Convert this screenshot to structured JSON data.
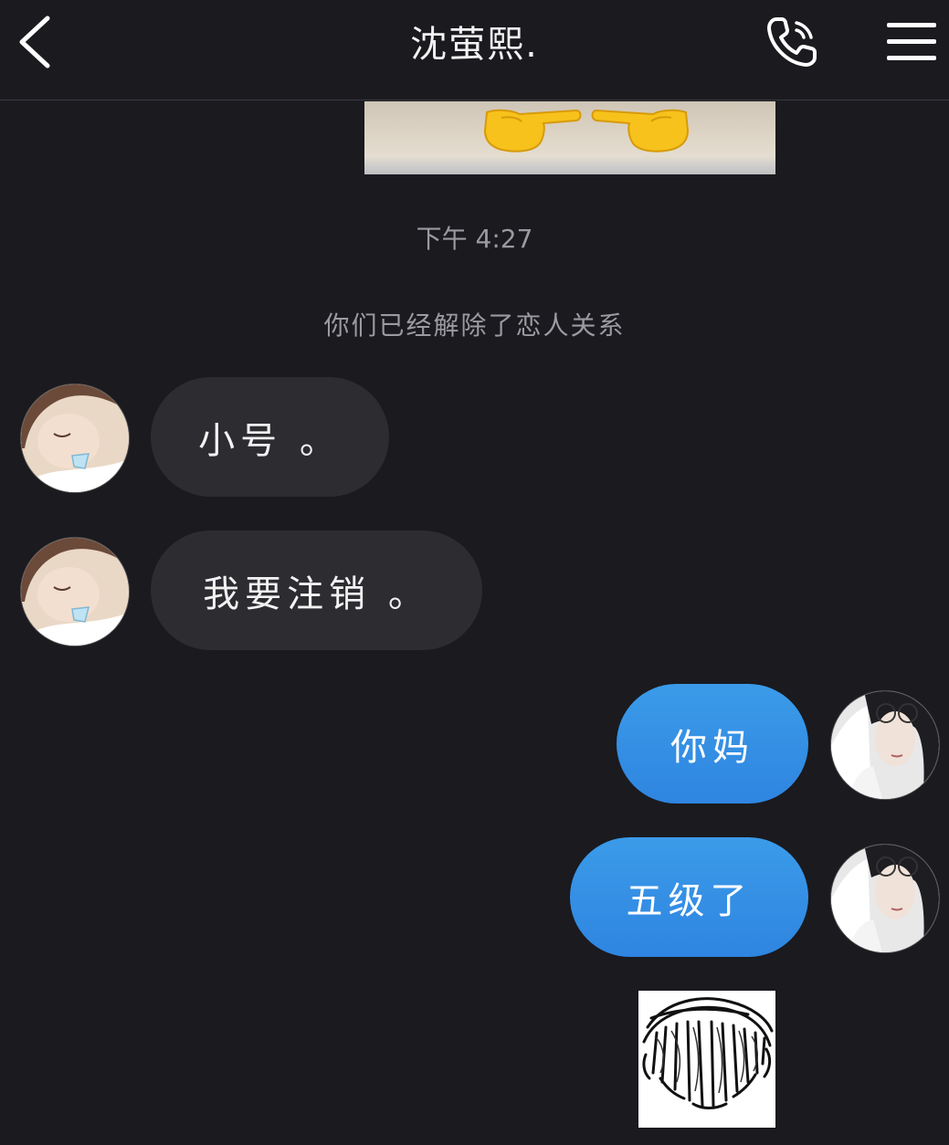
{
  "header": {
    "title": "沈萤熙.",
    "back_icon": "chevron-left-icon",
    "call_icon": "phone-icon",
    "menu_icon": "hamburger-menu-icon"
  },
  "timestamp": "下午 4:27",
  "system_notice": "你们已经解除了恋人关系",
  "messages": [
    {
      "side": "incoming",
      "text": "小号 。"
    },
    {
      "side": "incoming",
      "text": "我要注销 。"
    },
    {
      "side": "outgoing",
      "text": "你妈"
    },
    {
      "side": "outgoing",
      "text": "五级了"
    }
  ],
  "colors": {
    "background": "#1a1a1f",
    "incoming_bubble": "#2c2c31",
    "outgoing_bubble": "#3394e6",
    "muted_text": "#9a9aa0"
  }
}
